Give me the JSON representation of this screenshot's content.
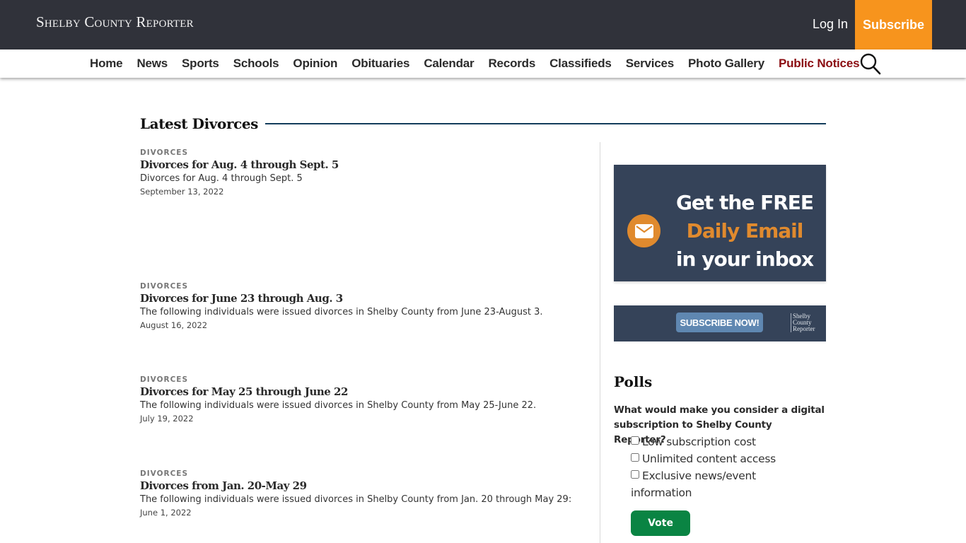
{
  "header": {
    "logo": "Shelby County Reporter",
    "login_label": "Log In",
    "subscribe_label": "Subscribe",
    "accent_color": "#f7941d"
  },
  "nav": {
    "items": [
      {
        "label": "Home"
      },
      {
        "label": "News"
      },
      {
        "label": "Sports"
      },
      {
        "label": "Schools"
      },
      {
        "label": "Opinion"
      },
      {
        "label": "Obituaries"
      },
      {
        "label": "Calendar"
      },
      {
        "label": "Records"
      },
      {
        "label": "Classifieds"
      },
      {
        "label": "Services"
      },
      {
        "label": "Photo Gallery"
      },
      {
        "label": "Public Notices",
        "highlight": true
      }
    ],
    "search_icon": "search-icon",
    "highlight_color": "#8b0d12"
  },
  "main": {
    "section_title": "Latest Divorces",
    "articles": [
      {
        "category": "Divorces",
        "title": "Divorces for Aug. 4 through Sept. 5",
        "description": "Divorces for Aug. 4 through Sept. 5",
        "date": "September 13, 2022"
      },
      {
        "category": "Divorces",
        "title": "Divorces for June 23 through Aug. 3",
        "description": "The following individuals were issued divorces in Shelby County from June 23-August 3.",
        "date": "August 16, 2022"
      },
      {
        "category": "Divorces",
        "title": "Divorces for May 25 through June 22",
        "description": "The following individuals were issued divorces in Shelby County from May 25-June 22.",
        "date": "July 19, 2022"
      },
      {
        "category": "Divorces",
        "title": "Divorces from Jan. 20-May 29",
        "description": "The following individuals were issued divorces in Shelby County from Jan. 20 through May 29:",
        "date": "June 1, 2022"
      }
    ]
  },
  "sidebar": {
    "email_ad": {
      "line1": "Get the FREE",
      "line2": "Daily Email",
      "line3": "in your inbox",
      "icon": "envelope-icon"
    },
    "subscribe_ad": {
      "button_label": "SUBSCRIBE NOW!",
      "logo_line1": "Shelby",
      "logo_line2": "County",
      "logo_line3": "Reporter"
    },
    "polls": {
      "title": "Polls",
      "question": "What would make you consider a digital subscription to Shelby County Reporter?",
      "options": [
        {
          "label": "Low subscription cost",
          "checked": false
        },
        {
          "label": "Unlimited content access",
          "checked": false
        },
        {
          "label": "Exclusive news/event information",
          "checked": false
        }
      ],
      "vote_label": "Vote",
      "vote_color": "#0a8443"
    }
  }
}
